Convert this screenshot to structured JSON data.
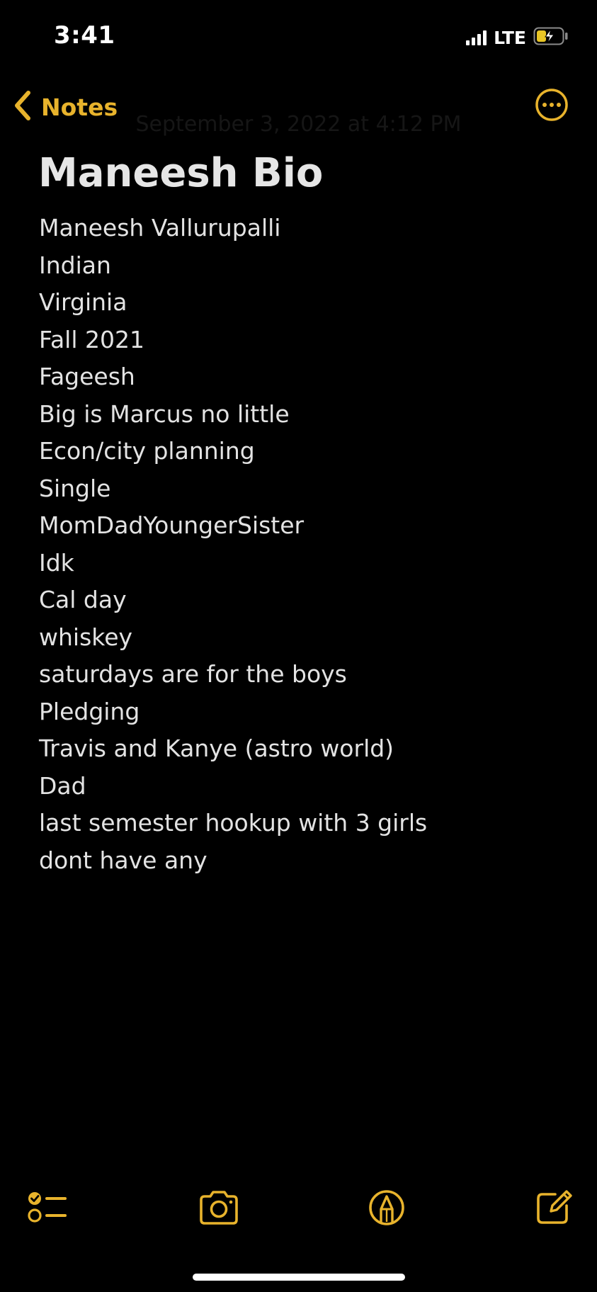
{
  "status_bar": {
    "time": "3:41",
    "network": "LTE",
    "battery_icon": "battery-charging-icon"
  },
  "nav": {
    "back_label": "Notes",
    "more_icon": "ellipsis-circle-icon"
  },
  "note": {
    "ghost_date": "September 3, 2022 at 4:12 PM",
    "title": "Maneesh Bio",
    "lines": [
      "Maneesh Vallurupalli",
      "Indian",
      "Virginia",
      "Fall 2021",
      "Fageesh",
      "Big is Marcus no little",
      "Econ/city planning",
      "Single",
      "MomDadYoungerSister",
      "Idk",
      "Cal day",
      "whiskey",
      "saturdays are for the boys",
      "Pledging",
      "Travis and Kanye (astro world)",
      "Dad",
      "last semester hookup with 3 girls",
      "dont have any"
    ]
  },
  "toolbar": {
    "icons": [
      "checklist-icon",
      "camera-icon",
      "markup-icon",
      "compose-icon"
    ]
  },
  "colors": {
    "accent": "#e8b32c",
    "background": "#000000",
    "text": "#e3e3e3"
  }
}
